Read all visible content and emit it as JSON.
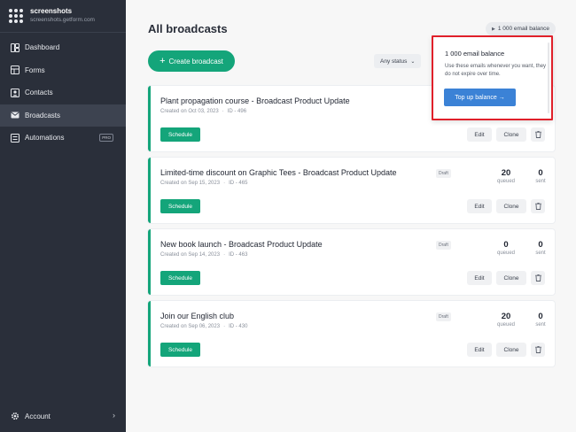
{
  "sidebar": {
    "brand_name": "screenshots",
    "brand_sub": "screenshots.getform.com",
    "items": [
      {
        "label": "Dashboard",
        "icon": "dashboard-icon"
      },
      {
        "label": "Forms",
        "icon": "forms-icon"
      },
      {
        "label": "Contacts",
        "icon": "contacts-icon"
      },
      {
        "label": "Broadcasts",
        "icon": "mail-icon",
        "active": true
      },
      {
        "label": "Automations",
        "icon": "automations-icon",
        "badge": "PRO"
      }
    ],
    "account_label": "Account"
  },
  "header": {
    "title": "All broadcasts",
    "balance_chip": "1 000 email balance"
  },
  "toolbar": {
    "create_label": "Create broadcast",
    "status_filter": "Any status"
  },
  "popover": {
    "title": "1 000 email balance",
    "description": "Use these emails whenever you want, they do not expire over time.",
    "button": "Top up balance →"
  },
  "broadcasts": [
    {
      "title": "Plant propagation course - Broadcast Product Update",
      "created": "Created on Oct 03, 2023",
      "id": "ID - 496",
      "draft": "",
      "queued": "",
      "sent": "",
      "queued_label": "",
      "sent_label": "",
      "schedule": "Schedule",
      "edit": "Edit",
      "clone": "Clone"
    },
    {
      "title": "Limited-time discount on Graphic Tees - Broadcast Product Update",
      "created": "Created on Sep 15, 2023",
      "id": "ID - 465",
      "draft": "Draft",
      "queued": "20",
      "sent": "0",
      "queued_label": "queued",
      "sent_label": "sent",
      "schedule": "Schedule",
      "edit": "Edit",
      "clone": "Clone"
    },
    {
      "title": "New book launch - Broadcast Product Update",
      "created": "Created on Sep 14, 2023",
      "id": "ID - 463",
      "draft": "Draft",
      "queued": "0",
      "sent": "0",
      "queued_label": "queued",
      "sent_label": "sent",
      "schedule": "Schedule",
      "edit": "Edit",
      "clone": "Clone"
    },
    {
      "title": "Join our English club",
      "created": "Created on Sep 06, 2023",
      "id": "ID - 430",
      "draft": "Draft",
      "queued": "20",
      "sent": "0",
      "queued_label": "queued",
      "sent_label": "sent",
      "schedule": "Schedule",
      "edit": "Edit",
      "clone": "Clone"
    }
  ],
  "colors": {
    "sidebar_bg": "#2a2f3a",
    "accent_green": "#14a57a",
    "accent_blue": "#3b82d6",
    "highlight_red": "#e0202a"
  }
}
